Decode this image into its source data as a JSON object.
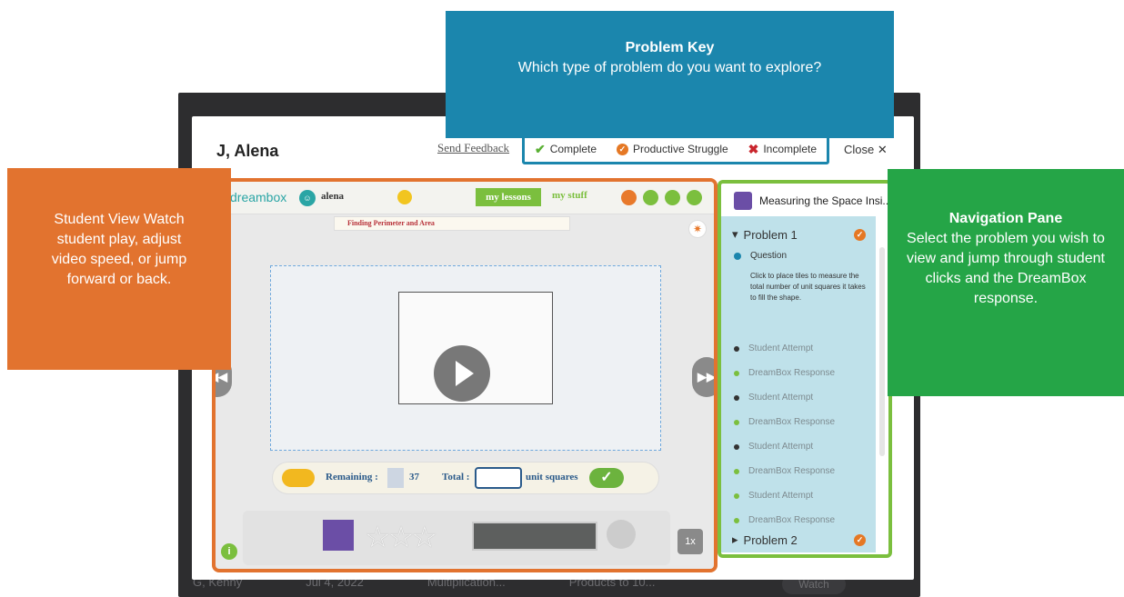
{
  "header": {
    "student_name": "J, Alena",
    "send_feedback": "Send Feedback",
    "close_label": "Close ✕"
  },
  "legend": {
    "complete": "Complete",
    "productive_struggle": "Productive Struggle",
    "incomplete": "Incomplete",
    "colors": {
      "complete": "#5ab034",
      "productive_struggle": "#e57824",
      "incomplete": "#c9262e"
    }
  },
  "callouts": {
    "problem_key": {
      "title": "Problem Key",
      "body": "Which type of problem do you want to explore?",
      "color": "#1b86ad"
    },
    "student_view": {
      "body": "Student View Watch student play, adjust video speed, or jump forward or back.",
      "color": "#e2732f"
    },
    "navigation_pane": {
      "title": "Navigation Pane",
      "body": "Select the problem you wish to view and jump through student clicks and the DreamBox response.",
      "color": "#25a547"
    }
  },
  "student_view": {
    "logo": "dreambox",
    "username": "alena",
    "my_lessons": "my lessons",
    "my_stuff": "my stuff",
    "lesson_ribbon": "Finding Perimeter and Area",
    "remaining_label": "Remaining :",
    "remaining_value": "37",
    "total_label": "Total :",
    "unit_label": "unit squares",
    "speed": "1x"
  },
  "nav": {
    "lesson_title": "Measuring the Space Insi...",
    "problem1": "Problem 1",
    "problem2": "Problem 2",
    "question_label": "Question",
    "question_text": "Click to place tiles to measure the total number of unit squares it takes to fill the shape.",
    "steps": [
      "Student Attempt",
      "DreamBox Response",
      "Student Attempt",
      "DreamBox Response",
      "Student Attempt",
      "DreamBox Response",
      "Student Attempt",
      "DreamBox Response"
    ]
  },
  "background_row": {
    "name": "G, Kenny",
    "date": "Jul 4, 2022",
    "col3": "Multiplication...",
    "col4": "Products to 10...",
    "watch": "Watch"
  }
}
